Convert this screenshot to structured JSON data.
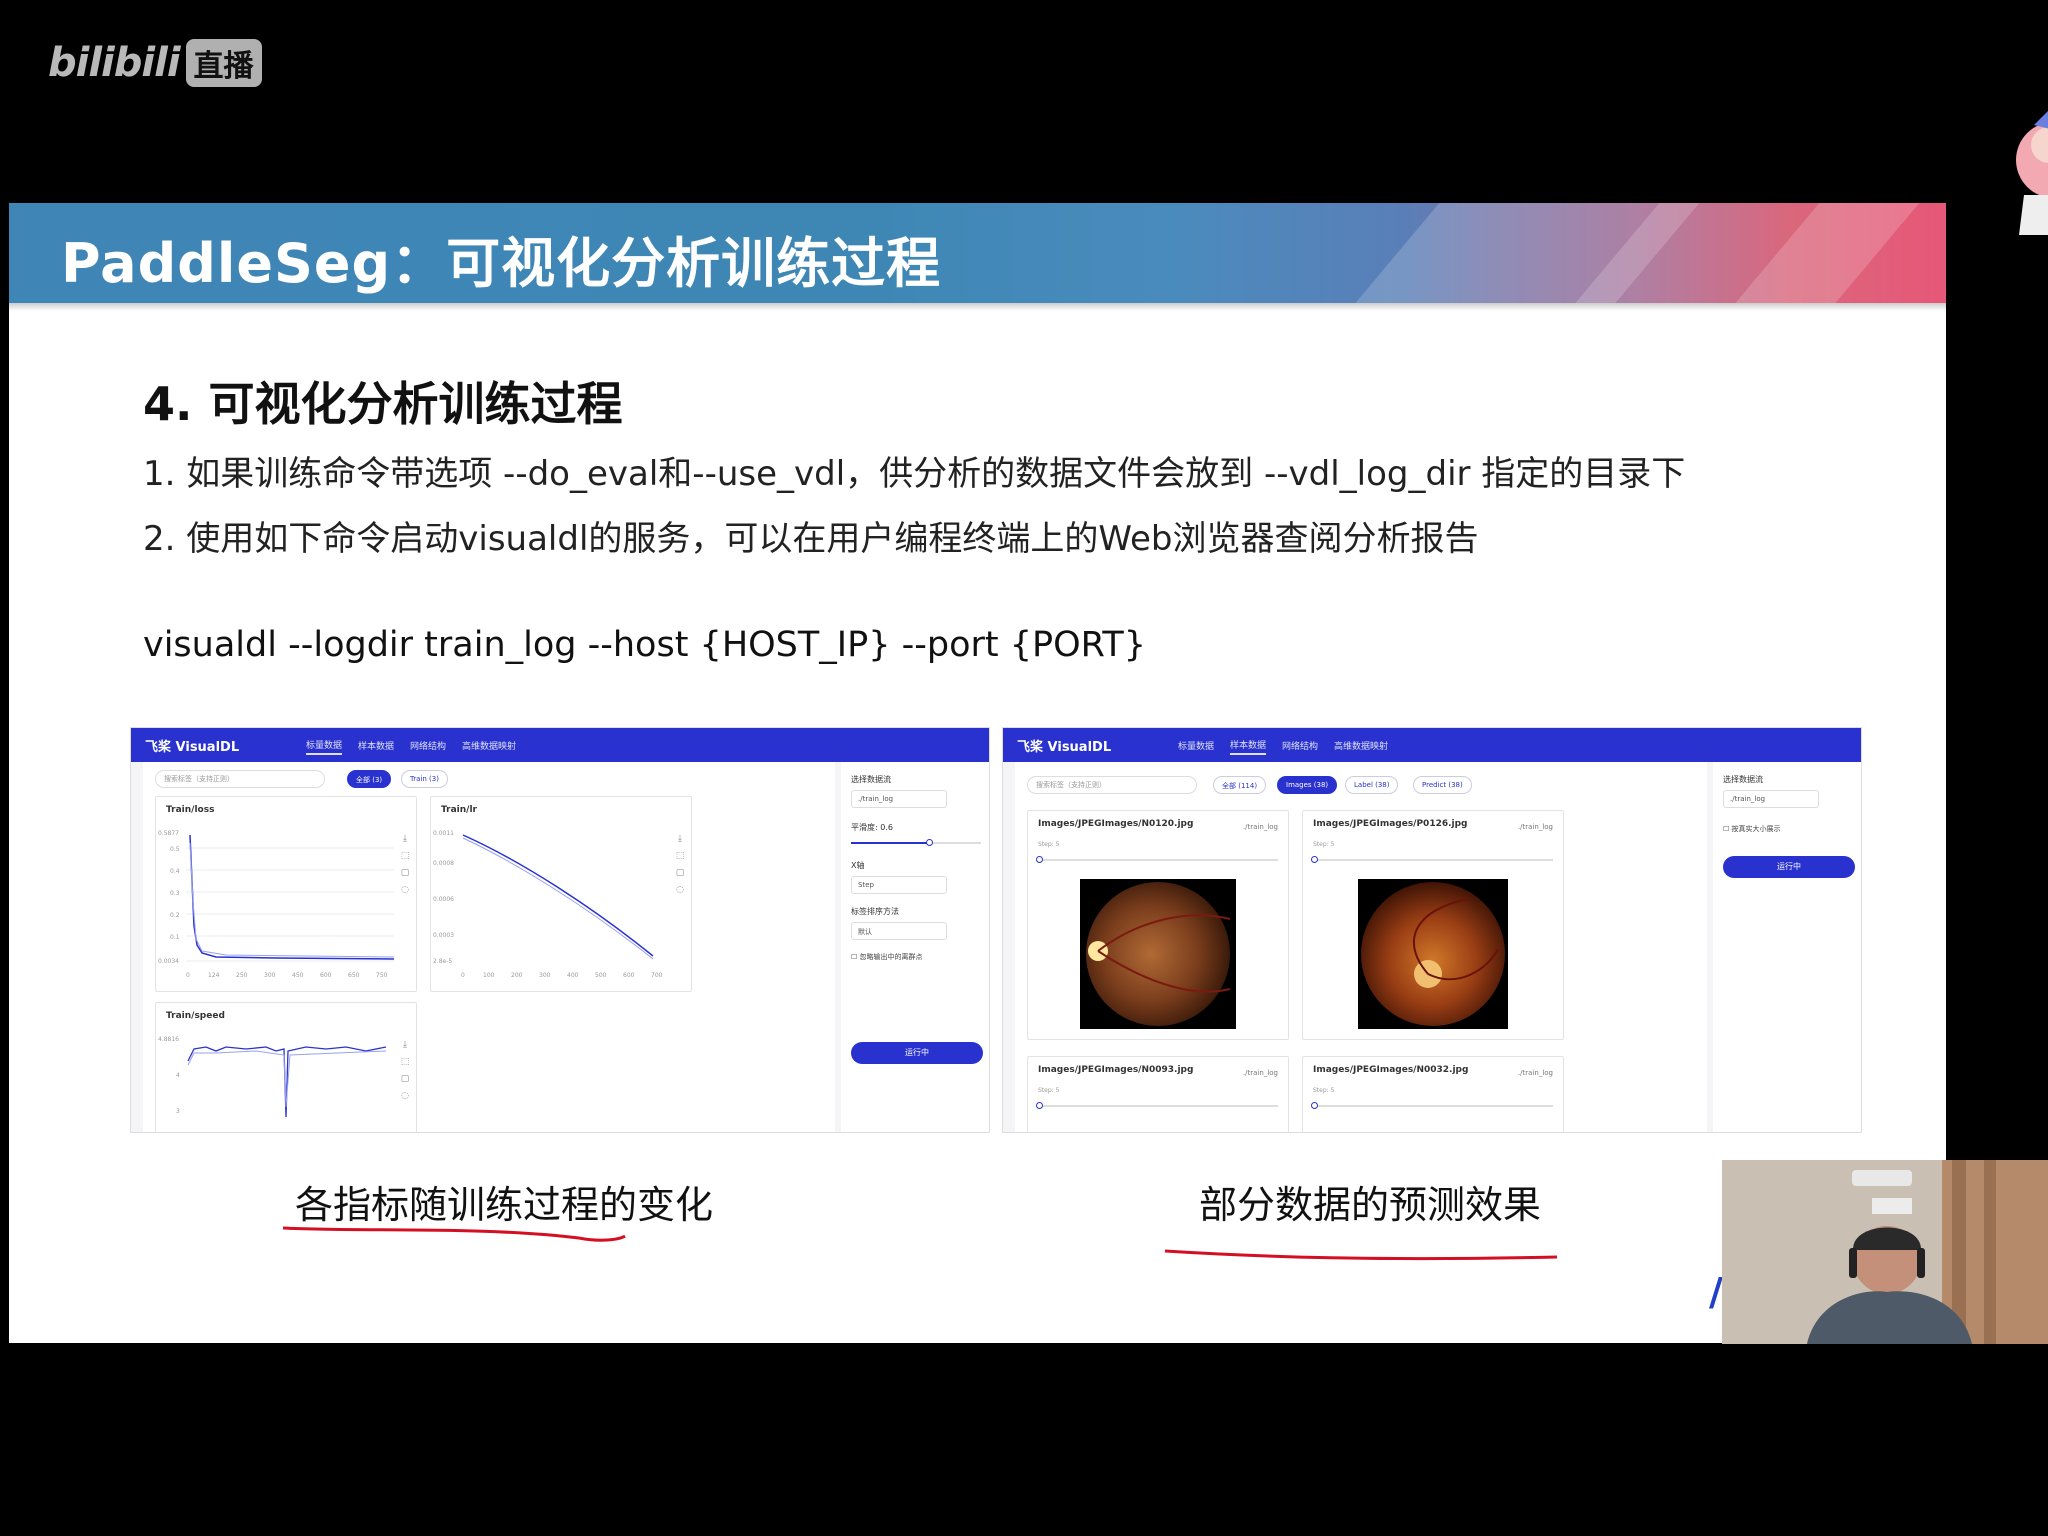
{
  "stream": {
    "platform_logo_text": "bilibili",
    "platform_badge": "直播"
  },
  "slide": {
    "banner_title": "PaddleSeg：可视化分析训练过程",
    "section_heading": "4. 可视化分析训练过程",
    "line1": "1. 如果训练命令带选项 --do_eval和--use_vdl，供分析的数据文件会放到 --vdl_log_dir 指定的目录下",
    "line2": "2. 使用如下命令启动visualdl的服务，可以在用户编程终端上的Web浏览器查阅分析报告",
    "command": "visualdl --logdir train_log --host {HOST_IP} --port {PORT}",
    "caption_left": "各指标随训练过程的变化",
    "caption_right": "部分数据的预测效果",
    "underline_color": "#d40f23"
  },
  "vdl_left": {
    "brand": "飞桨 VisualDL",
    "nav": [
      "标量数据",
      "样本数据",
      "网络结构",
      "高维数据映射"
    ],
    "search_placeholder": "搜索标签（支持正则）",
    "pills": [
      "全部 (3)",
      "Train (3)"
    ],
    "charts": [
      {
        "title": "Train/loss",
        "ymax": "0.5877",
        "ymin": "0.0034",
        "yticks": [
          "0.5",
          "0.4",
          "0.3",
          "0.2",
          "0.1"
        ],
        "xticks": [
          "0",
          "124",
          "250",
          "300",
          "450",
          "600",
          "650",
          "750"
        ]
      },
      {
        "title": "Train/lr",
        "ymax": "0.0011",
        "ymin": "2.8e-5",
        "yticks": [
          "0.0008",
          "0.0006",
          "0.0003"
        ],
        "xticks": [
          "0",
          "100",
          "200",
          "300",
          "400",
          "500",
          "600",
          "700"
        ]
      },
      {
        "title": "Train/speed",
        "ymax": "4.8816",
        "yticks": [
          "4",
          "3"
        ]
      }
    ],
    "side": {
      "label_run": "选择数据流",
      "run_value": "./train_log",
      "smoothing_label": "平滑度: 0.6",
      "xaxis_label": "X轴",
      "xaxis_value": "Step",
      "sort_label": "标签排序方法",
      "sort_value": "默认",
      "check_label": "忽略输出中的离群点",
      "button": "运行中"
    }
  },
  "vdl_right": {
    "brand": "飞桨 VisualDL",
    "nav": [
      "标量数据",
      "样本数据",
      "网络结构",
      "高维数据映射"
    ],
    "search_placeholder": "搜索标签（支持正则）",
    "pills": [
      "全部 (114)",
      "Images (38)",
      "Label (38)",
      "Predict (38)"
    ],
    "cards": [
      {
        "title": "Images/JPEGImages/N0120.jpg",
        "path": "./train_log",
        "step": "Step: 5"
      },
      {
        "title": "Images/JPEGImages/P0126.jpg",
        "path": "./train_log",
        "step": "Step: 5"
      },
      {
        "title": "Images/JPEGImages/N0093.jpg",
        "path": "./train_log",
        "step": "Step: 5"
      },
      {
        "title": "Images/JPEGImages/N0032.jpg",
        "path": "./train_log",
        "step": "Step: 5"
      }
    ],
    "side": {
      "label_run": "选择数据流",
      "run_value": "./train_log",
      "check_label": "按真实大小展示",
      "button": "运行中"
    }
  }
}
